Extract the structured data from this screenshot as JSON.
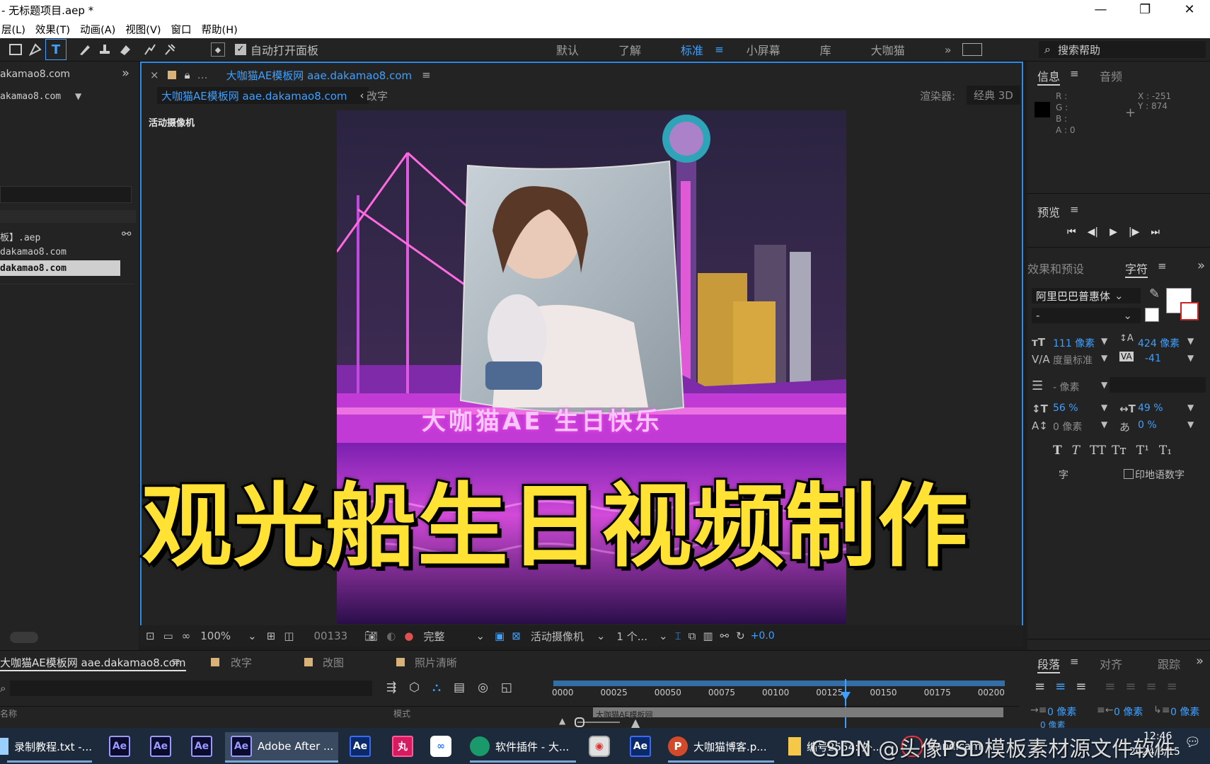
{
  "window": {
    "title": "- 无标题项目.aep *",
    "controls": [
      "—",
      "❐",
      "✕"
    ]
  },
  "menu": [
    "层(L)",
    "效果(T)",
    "动画(A)",
    "视图(V)",
    "窗口",
    "帮助(H)"
  ],
  "toolbar": {
    "auto_open": "自动打开面板",
    "workspaces": [
      "默认",
      "了解",
      "标准",
      "小屏幕",
      "库",
      "大咖猫"
    ],
    "active_workspace": "标准",
    "search_placeholder": "搜索帮助"
  },
  "left_panel": {
    "lines": [
      "akamao8.com",
      "akamao8.com",
      "板】.aep",
      "dakamao8.com",
      "dakamao8.com"
    ]
  },
  "comp": {
    "tab_title": "大咖猫AE模板网 aae.dakamao8.com",
    "breadcrumb_active": "大咖猫AE模板网 aae.dakamao8.com",
    "breadcrumb_next": "改字",
    "renderer_label": "渲染器:",
    "renderer_value": "经典 3D",
    "camera_label": "活动摄像机",
    "scene_banner_text": "大咖猫AE 生日快乐",
    "zoom": "100%",
    "timecode": "00133",
    "resolution": "完整",
    "view": "活动摄像机",
    "views_count": "1 个...",
    "exposure": "+0.0"
  },
  "overlay_title": "观光船生日视频制作",
  "right_panel": {
    "info_tab": "信息",
    "audio_tab": "音频",
    "r": "R :",
    "g": "G :",
    "b": "B :",
    "a": "A : 0",
    "x": "X : -251",
    "y": "Y : 874",
    "preview": "预览",
    "effects_tab": "效果和预设",
    "char_tab": "字符",
    "font_name": "阿里巴巴普惠体",
    "font_style": "-",
    "font_size": "111 像素",
    "leading": "424 像素",
    "kerning": "度量标准",
    "tracking": "-41",
    "stroke_width": "- 像素",
    "vscale": "56 %",
    "hscale": "49 %",
    "baseline": "0 像素",
    "tsume": "0 %",
    "hindi_digits": "印地语数字",
    "zi": "字",
    "para_tab": "段落",
    "align_tab": "对齐",
    "track_tab": "跟踪",
    "indent": [
      "0 像素",
      "0 像素",
      "0 像素",
      "0 像素"
    ]
  },
  "timeline": {
    "comp_tab": "大咖猫AE模板网 aae.dakamao8.com",
    "tabs": [
      "改字",
      "改图",
      "照片清晰"
    ],
    "ticks": [
      "0000",
      "00025",
      "00050",
      "00075",
      "00100",
      "00125",
      "00150",
      "00175",
      "00200"
    ],
    "layer_name_partial": "大咖猫AE模板网",
    "col_header": "名称",
    "mode_header": "模式"
  },
  "taskbar": {
    "items": [
      "录制教程.txt -...",
      "Adobe After ...",
      "软件插件 - 大...",
      "大咖猫博客.p...",
      "编号2554: 外...",
      "Bandicam"
    ],
    "date": "2024/8/15",
    "time": "12:46"
  },
  "watermark": "CSDN @头像PSD模板素材源文件软件"
}
